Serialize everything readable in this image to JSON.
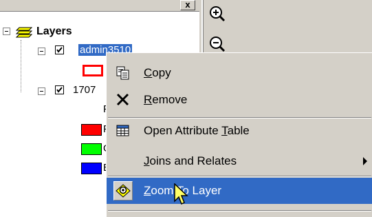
{
  "toc": {
    "close_glyph": "x",
    "root_label": "Layers",
    "layer1": {
      "name": "admin3510"
    },
    "layer2": {
      "name": "1707",
      "sub_label": "F",
      "legend": [
        {
          "label": "F",
          "color": "#ff0000"
        },
        {
          "label": "G",
          "color": "#00ff00"
        },
        {
          "label": "E",
          "color": "#0000ff"
        }
      ]
    }
  },
  "context_menu": {
    "items": [
      {
        "id": "copy",
        "pre": "",
        "u": "C",
        "post": "opy",
        "icon": "copy-icon"
      },
      {
        "id": "remove",
        "pre": "",
        "u": "R",
        "post": "emove",
        "icon": "remove-icon"
      },
      {
        "id": "open-attribute-table",
        "pre": "Open Attribute ",
        "u": "T",
        "post": "able",
        "icon": "table-icon"
      },
      {
        "id": "joins-and-relates",
        "pre": "",
        "u": "J",
        "post": "oins and Relates",
        "icon": ""
      },
      {
        "id": "zoom-to-layer",
        "pre": "",
        "u": "Z",
        "post": "oom To Layer",
        "icon": "zoom-to-layer-icon"
      }
    ],
    "highlighted": "zoom-to-layer"
  },
  "toolbar": {
    "tools": [
      "zoom-in-icon",
      "zoom-out-icon"
    ]
  },
  "colors": {
    "selection": "#316ac5",
    "face": "#d4d0c8",
    "layer1_symbol_outline": "#ff0000"
  }
}
